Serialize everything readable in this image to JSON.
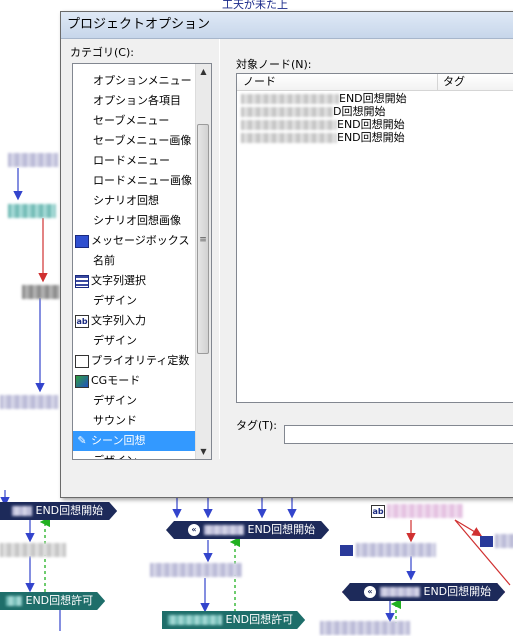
{
  "background": {
    "top_node": "工天が未た上",
    "end_nodes": [
      {
        "label": "END回想開始"
      },
      {
        "label": "END回想開始"
      },
      {
        "label": "END回想開始"
      }
    ],
    "allow_nodes": [
      {
        "label": "END回想許可"
      },
      {
        "label": "END回想許可"
      }
    ],
    "icon_ab": "ab"
  },
  "dialog": {
    "title": "プロジェクトオプション",
    "category_label": "カテゴリ(C):",
    "target_label": "対象ノード(N):",
    "tag_label": "タグ(T):",
    "tag_value": "",
    "columns": [
      "ノード",
      "タグ"
    ],
    "categories": [
      {
        "label": "オプションメニュー",
        "level": 1,
        "icon": ""
      },
      {
        "label": "オプション各項目",
        "level": 1,
        "icon": ""
      },
      {
        "label": "セーブメニュー",
        "level": 1,
        "icon": ""
      },
      {
        "label": "セーブメニュー画像",
        "level": 1,
        "icon": ""
      },
      {
        "label": "ロードメニュー",
        "level": 1,
        "icon": ""
      },
      {
        "label": "ロードメニュー画像",
        "level": 1,
        "icon": ""
      },
      {
        "label": "シナリオ回想",
        "level": 1,
        "icon": ""
      },
      {
        "label": "シナリオ回想画像",
        "level": 1,
        "icon": ""
      },
      {
        "label": "メッセージボックス",
        "level": 0,
        "icon": "message-box-icon"
      },
      {
        "label": "名前",
        "level": 1,
        "icon": ""
      },
      {
        "label": "文字列選択",
        "level": 0,
        "icon": "string-select-icon"
      },
      {
        "label": "デザイン",
        "level": 1,
        "icon": ""
      },
      {
        "label": "文字列入力",
        "level": 0,
        "icon": "string-input-icon"
      },
      {
        "label": "デザイン",
        "level": 1,
        "icon": ""
      },
      {
        "label": "プライオリティ定数",
        "level": 0,
        "icon": "priority-icon"
      },
      {
        "label": "CGモード",
        "level": 0,
        "icon": "cg-mode-icon"
      },
      {
        "label": "デザイン",
        "level": 1,
        "icon": ""
      },
      {
        "label": "サウンド",
        "level": 1,
        "icon": ""
      },
      {
        "label": "シーン回想",
        "level": 0,
        "icon": "scene-recall-icon",
        "selected": true
      },
      {
        "label": "デザイン",
        "level": 1,
        "icon": ""
      }
    ],
    "node_rows": [
      {
        "text": "END回想開始"
      },
      {
        "text": "D回想開始"
      },
      {
        "text": "END回想開始"
      },
      {
        "text": "END回想開始"
      }
    ]
  }
}
